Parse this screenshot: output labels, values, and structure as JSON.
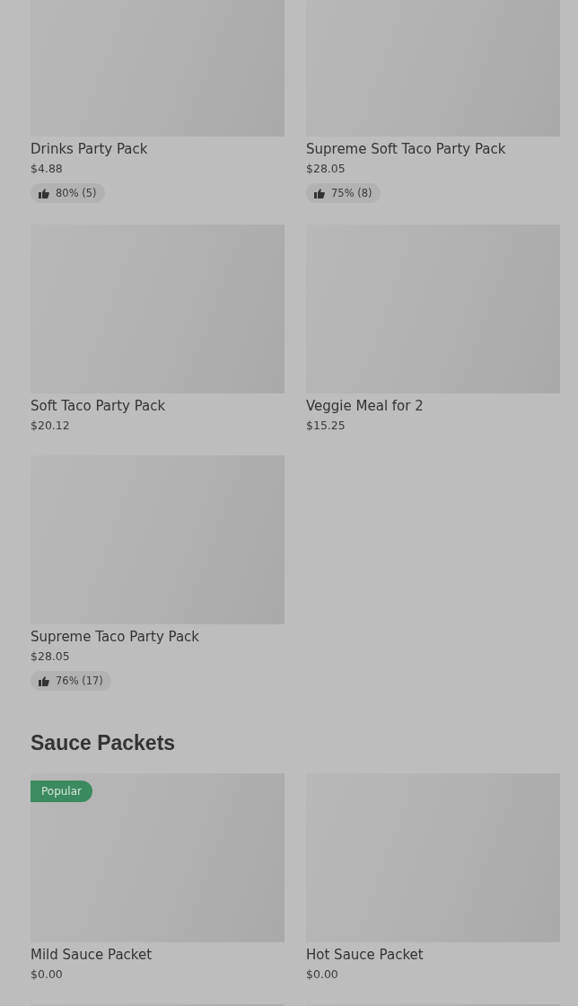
{
  "sections": [
    {
      "items": [
        {
          "kind": "product",
          "name": "Drinks Party Pack",
          "price": "$4.88",
          "rating": "80% (5)"
        },
        {
          "kind": "product",
          "name": "Supreme Soft Taco Party Pack",
          "price": "$28.05",
          "rating": "75% (8)"
        },
        {
          "kind": "product",
          "name": "Soft Taco Party Pack",
          "price": "$20.12"
        },
        {
          "kind": "product",
          "name": "Veggie Meal for 2",
          "price": "$15.25"
        },
        {
          "kind": "product",
          "name": "Supreme Taco Party Pack",
          "price": "$28.05",
          "rating": "76% (17)"
        }
      ]
    },
    {
      "title": "Sauce Packets",
      "items": [
        {
          "kind": "product",
          "name": "Mild Sauce Packet",
          "price": "$0.00",
          "badge": "Popular"
        },
        {
          "kind": "product",
          "name": "Hot Sauce Packet",
          "price": "$0.00"
        },
        {
          "kind": "picture"
        },
        {
          "kind": "picture"
        }
      ]
    }
  ]
}
